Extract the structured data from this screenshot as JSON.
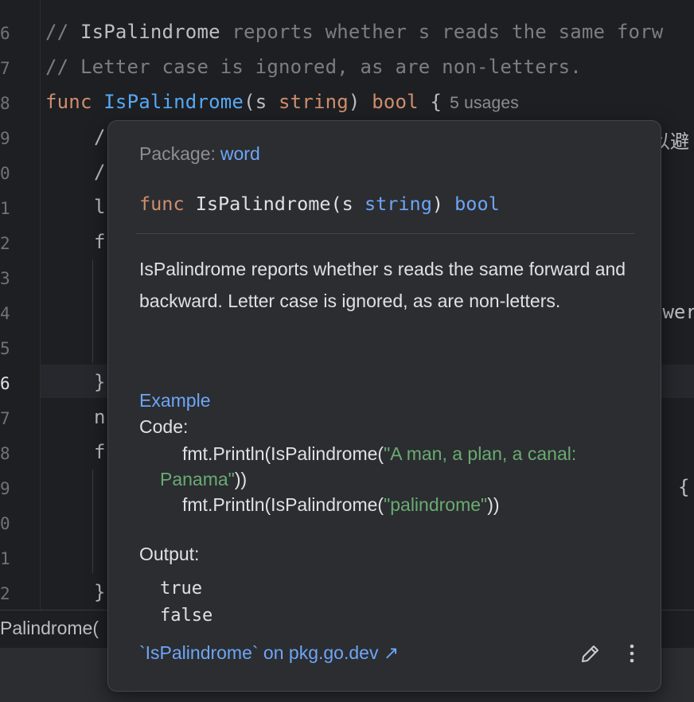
{
  "editor": {
    "line_numbers": [
      "6",
      "7",
      "8",
      "9",
      "0",
      "1",
      "2",
      "3",
      "4",
      "5",
      "6",
      "7",
      "8",
      "9",
      "0",
      "1",
      "2"
    ],
    "comment1_name": "IsPalindrome",
    "comment1_rest": " reports whether s reads the same forw",
    "comment2": "// Letter case is ignored, as are non-letters.",
    "func_kw": "func",
    "func_name": "IsPalindrome",
    "func_params_open": "(s ",
    "func_param_type": "string",
    "func_params_close": ") ",
    "func_return": "bool",
    "func_brace": " {",
    "usages_hint": "5 usages",
    "partial_frags": [
      "/",
      "/",
      "l",
      "f",
      "}",
      "n",
      "f",
      "}",
      "以避",
      "ower",
      "{"
    ]
  },
  "breadcrumb": "Palindrome(",
  "popup": {
    "package_label": "Package:",
    "package_name": "word",
    "signature": {
      "kw": "func",
      "name": " IsPalindrome(s ",
      "param_type": "string",
      "close": ") ",
      "return_type": "bool"
    },
    "description": "IsPalindrome reports whether s reads the same forward and backward. Letter case is ignored, as are non-letters.",
    "example_title": "Example",
    "code_label": "Code:",
    "code_line1_pre": "fmt.Println(IsPalindrome(",
    "code_line1_str": "\"A man, a plan, a canal: Panama\"",
    "code_line1_post": "))",
    "code_line2_pre": "fmt.Println(IsPalindrome(",
    "code_line2_str": "\"palindrome\"",
    "code_line2_post": "))",
    "output_label": "Output:",
    "output_values": [
      "true",
      "false"
    ],
    "link_text": "`IsPalindrome` on pkg.go.dev ↗",
    "icons": [
      "pencil-icon",
      "more-vertical-icon"
    ]
  },
  "colors": {
    "background": "#1e1f22",
    "popup_bg": "#2b2d30",
    "keyword": "#cf8e6d",
    "function": "#56a8f5",
    "link": "#6ea5f7",
    "string": "#6aab73",
    "comment": "#7a7e85"
  }
}
